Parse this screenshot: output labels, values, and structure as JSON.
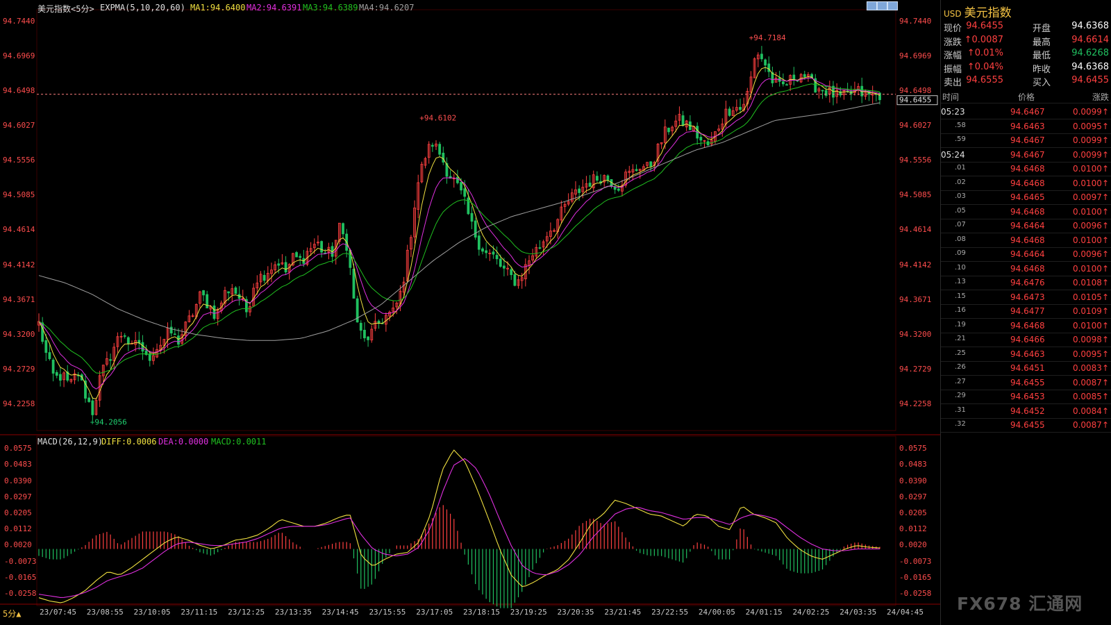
{
  "header": {
    "title": "美元指数<5分>",
    "expma": "EXPMA(5,10,20,60)",
    "ma1": "MA1:94.6400",
    "ma2": "MA2:94.6391",
    "ma3": "MA3:94.6389",
    "ma4": "MA4:94.6207"
  },
  "macd_header": {
    "name": "MACD(26,12,9)",
    "diff": "DIFF:0.0006",
    "dea": "DEA:0.0000",
    "macd": "MACD:0.0011"
  },
  "period_selector": "5分▲",
  "watermark": "FX678 汇通网",
  "colors": {
    "up": "#ff4040",
    "down": "#20c060",
    "ma1": "#f0e040",
    "ma2": "#e030e0",
    "ma3": "#20c020",
    "ma4": "#a0a0a0",
    "diff": "#f0e040",
    "dea": "#e030e0"
  },
  "quote_panel": {
    "currency": "USD",
    "name": "美元指数",
    "rows": [
      {
        "l1": "现价",
        "v1": "94.6455",
        "c1": "#ff4040",
        "l2": "开盘",
        "v2": "94.6368",
        "c2": "#ffffff"
      },
      {
        "l1": "涨跌",
        "v1": "↑0.0087",
        "c1": "#ff4040",
        "l2": "最高",
        "v2": "94.6614",
        "c2": "#ff4040"
      },
      {
        "l1": "涨幅",
        "v1": "↑0.01%",
        "c1": "#ff4040",
        "l2": "最低",
        "v2": "94.6268",
        "c2": "#20c060"
      },
      {
        "l1": "振幅",
        "v1": "↑0.04%",
        "c1": "#ff4040",
        "l2": "昨收",
        "v2": "94.6368",
        "c2": "#ffffff"
      },
      {
        "l1": "卖出",
        "v1": "94.6555",
        "c1": "#ff4040",
        "l2": "买入",
        "v2": "94.6455",
        "c2": "#ff4040"
      }
    ],
    "ticks_header": {
      "time": "时间",
      "price": "价格",
      "change": "涨跌"
    },
    "ticks": [
      {
        "time": "05:23",
        "price": "94.6467",
        "change": "0.0099"
      },
      {
        "time": ".58",
        "price": "94.6463",
        "change": "0.0095"
      },
      {
        "time": ".59",
        "price": "94.6467",
        "change": "0.0099"
      },
      {
        "time": "05:24",
        "price": "94.6467",
        "change": "0.0099"
      },
      {
        "time": ".01",
        "price": "94.6468",
        "change": "0.0100"
      },
      {
        "time": ".02",
        "price": "94.6468",
        "change": "0.0100"
      },
      {
        "time": ".03",
        "price": "94.6465",
        "change": "0.0097"
      },
      {
        "time": ".05",
        "price": "94.6468",
        "change": "0.0100"
      },
      {
        "time": ".07",
        "price": "94.6464",
        "change": "0.0096"
      },
      {
        "time": ".08",
        "price": "94.6468",
        "change": "0.0100"
      },
      {
        "time": ".09",
        "price": "94.6464",
        "change": "0.0096"
      },
      {
        "time": ".10",
        "price": "94.6468",
        "change": "0.0100"
      },
      {
        "time": ".13",
        "price": "94.6476",
        "change": "0.0108"
      },
      {
        "time": ".15",
        "price": "94.6473",
        "change": "0.0105"
      },
      {
        "time": ".16",
        "price": "94.6477",
        "change": "0.0109"
      },
      {
        "time": ".19",
        "price": "94.6468",
        "change": "0.0100"
      },
      {
        "time": ".21",
        "price": "94.6466",
        "change": "0.0098"
      },
      {
        "time": ".25",
        "price": "94.6463",
        "change": "0.0095"
      },
      {
        "time": ".26",
        "price": "94.6451",
        "change": "0.0083"
      },
      {
        "time": ".27",
        "price": "94.6455",
        "change": "0.0087"
      },
      {
        "time": ".29",
        "price": "94.6453",
        "change": "0.0085"
      },
      {
        "time": ".31",
        "price": "94.6452",
        "change": "0.0084"
      },
      {
        "time": ".32",
        "price": "94.6455",
        "change": "0.0087"
      }
    ]
  },
  "chart_data": [
    {
      "type": "candlestick",
      "y_ticks": [
        "94.7440",
        "94.6969",
        "94.6498",
        "94.6027",
        "94.5556",
        "94.5085",
        "94.4614",
        "94.4142",
        "94.3671",
        "94.3200",
        "94.2729",
        "94.2258"
      ],
      "ylim": [
        94.19,
        94.76
      ],
      "x_ticks": [
        "23/07:45",
        "23/08:55",
        "23/10:05",
        "23/11:15",
        "23/12:25",
        "23/13:35",
        "23/14:45",
        "23/15:55",
        "23/17:05",
        "23/18:15",
        "23/19:25",
        "23/20:35",
        "23/21:45",
        "23/22:55",
        "24/00:05",
        "24/01:15",
        "24/02:25",
        "24/03:35",
        "24/04:45"
      ],
      "last_price": "94.6455",
      "annotations": [
        {
          "label": "94.2056",
          "value": 94.2056,
          "x_tick": "23/08:55"
        },
        {
          "label": "94.6102",
          "value": 94.6102,
          "x_tick": "23/17:05"
        },
        {
          "label": "94.7184",
          "value": 94.7184,
          "x_tick": "24/01:15"
        }
      ],
      "close_path": [
        94.335,
        94.29,
        94.26,
        94.265,
        94.25,
        94.27,
        94.24,
        94.215,
        94.265,
        94.285,
        94.31,
        94.325,
        94.3,
        94.31,
        94.285,
        94.3,
        94.31,
        94.325,
        94.31,
        94.33,
        94.35,
        94.375,
        94.36,
        94.345,
        94.375,
        94.385,
        94.37,
        94.35,
        94.395,
        94.4,
        94.41,
        94.42,
        94.405,
        94.425,
        94.42,
        94.435,
        94.445,
        94.43,
        94.43,
        94.465,
        94.44,
        94.35,
        94.31,
        94.32,
        94.335,
        94.345,
        94.35,
        94.38,
        94.44,
        94.52,
        94.56,
        94.58,
        94.565,
        94.54,
        94.525,
        94.505,
        94.47,
        94.445,
        94.43,
        94.425,
        94.41,
        94.4,
        94.39,
        94.41,
        94.43,
        94.44,
        94.46,
        94.47,
        94.49,
        94.505,
        94.515,
        94.525,
        94.53,
        94.535,
        94.53,
        94.52,
        94.535,
        94.54,
        94.55,
        94.545,
        94.565,
        94.59,
        94.605,
        94.61,
        94.605,
        94.595,
        94.58,
        94.575,
        94.6,
        94.62,
        94.63,
        94.625,
        94.65,
        94.705,
        94.69,
        94.665,
        94.655,
        94.66,
        94.67,
        94.675,
        94.66,
        94.655,
        94.65,
        94.645,
        94.64,
        94.645,
        94.65,
        94.645,
        94.643,
        94.6455
      ],
      "ma4_path": [
        94.4,
        94.39,
        94.375,
        94.355,
        94.34,
        94.328,
        94.32,
        94.315,
        94.312,
        94.312,
        94.315,
        94.325,
        94.34,
        94.36,
        94.39,
        94.42,
        94.445,
        94.465,
        94.48,
        94.49,
        94.5,
        94.512,
        94.525,
        94.54,
        94.555,
        94.57,
        94.58,
        94.595,
        94.61,
        94.615,
        94.62,
        94.627,
        94.634
      ]
    },
    {
      "type": "macd",
      "title": "MACD(26,12,9)",
      "y_ticks": [
        "0.0575",
        "0.0483",
        "0.0390",
        "0.0297",
        "0.0205",
        "0.0112",
        "0.0020",
        "-0.0073",
        "-0.0165",
        "-0.0258"
      ],
      "ylim": [
        -0.0325,
        0.06
      ],
      "diff_path": [
        -0.028,
        -0.03,
        -0.031,
        -0.028,
        -0.024,
        -0.018,
        -0.013,
        -0.015,
        -0.011,
        -0.006,
        -0.001,
        0.004,
        0.007,
        0.005,
        0.002,
        0.0,
        0.002,
        0.005,
        0.006,
        0.008,
        0.012,
        0.017,
        0.015,
        0.013,
        0.013,
        0.015,
        0.018,
        0.02,
        -0.004,
        -0.01,
        -0.006,
        -0.003,
        -0.002,
        0.004,
        0.02,
        0.045,
        0.057,
        0.05,
        0.035,
        0.018,
        0.0,
        -0.015,
        -0.022,
        -0.019,
        -0.015,
        -0.012,
        -0.006,
        0.004,
        0.015,
        0.02,
        0.028,
        0.026,
        0.023,
        0.02,
        0.019,
        0.016,
        0.013,
        0.02,
        0.019,
        0.013,
        0.011,
        0.025,
        0.02,
        0.018,
        0.015,
        0.006,
        0.0,
        -0.004,
        -0.006,
        -0.003,
        0.0,
        0.002,
        0.001,
        0.0006
      ],
      "dea_path": [
        -0.026,
        -0.027,
        -0.028,
        -0.027,
        -0.025,
        -0.022,
        -0.018,
        -0.016,
        -0.014,
        -0.011,
        -0.006,
        -0.001,
        0.003,
        0.004,
        0.003,
        0.002,
        0.002,
        0.003,
        0.004,
        0.006,
        0.009,
        0.012,
        0.013,
        0.013,
        0.013,
        0.014,
        0.016,
        0.018,
        0.008,
        0.0,
        -0.003,
        -0.004,
        -0.003,
        0.001,
        0.012,
        0.032,
        0.048,
        0.052,
        0.046,
        0.033,
        0.017,
        0.002,
        -0.01,
        -0.014,
        -0.015,
        -0.013,
        -0.009,
        -0.003,
        0.006,
        0.013,
        0.02,
        0.023,
        0.024,
        0.022,
        0.021,
        0.019,
        0.017,
        0.018,
        0.018,
        0.016,
        0.014,
        0.018,
        0.02,
        0.019,
        0.017,
        0.012,
        0.007,
        0.003,
        0.0,
        -0.001,
        -0.001,
        0.0,
        0.0,
        0.0
      ]
    }
  ]
}
